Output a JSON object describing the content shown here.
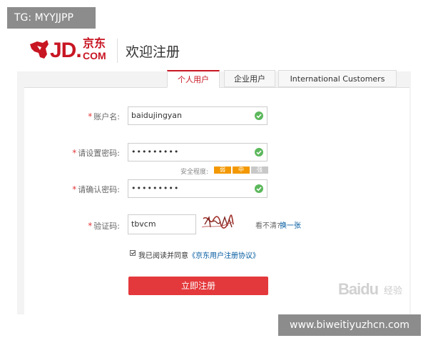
{
  "overlay_tag": "TG: MYYJJPP",
  "logo": {
    "main": "JD.",
    "cn": "京东",
    "com": "COM"
  },
  "header": {
    "title": "欢迎注册"
  },
  "tabs": [
    {
      "label": "个人用户",
      "active": true
    },
    {
      "label": "企业用户",
      "active": false
    },
    {
      "label": "International Customers",
      "active": false
    }
  ],
  "form": {
    "username": {
      "label": "账户名:",
      "value": "baidujingyan",
      "valid": true
    },
    "password": {
      "label": "请设置密码:",
      "value": "•••••••••",
      "valid": true
    },
    "strength": {
      "label": "安全程度:",
      "levels": [
        "弱",
        "中",
        "强"
      ],
      "active_levels": 2
    },
    "confirm": {
      "label": "请确认密码:",
      "value": "•••••••••",
      "valid": true
    },
    "captcha": {
      "label": "验证码:",
      "value": "tbvcm",
      "hint": "看不清?",
      "refresh_link": "换一张"
    },
    "agreement": {
      "text": "我已阅读并同意",
      "link": "《京东用户注册协议》",
      "checked": true
    },
    "submit_label": "立即注册"
  },
  "watermark": {
    "baidu": "Baidu",
    "jingyan": "经验"
  },
  "site_tag": "www.biweitiyuzhcn.com",
  "colors": {
    "brand_red": "#c81623",
    "button_red": "#e4393c",
    "valid_green": "#5cb85c",
    "strength_orange": "#f39800"
  }
}
